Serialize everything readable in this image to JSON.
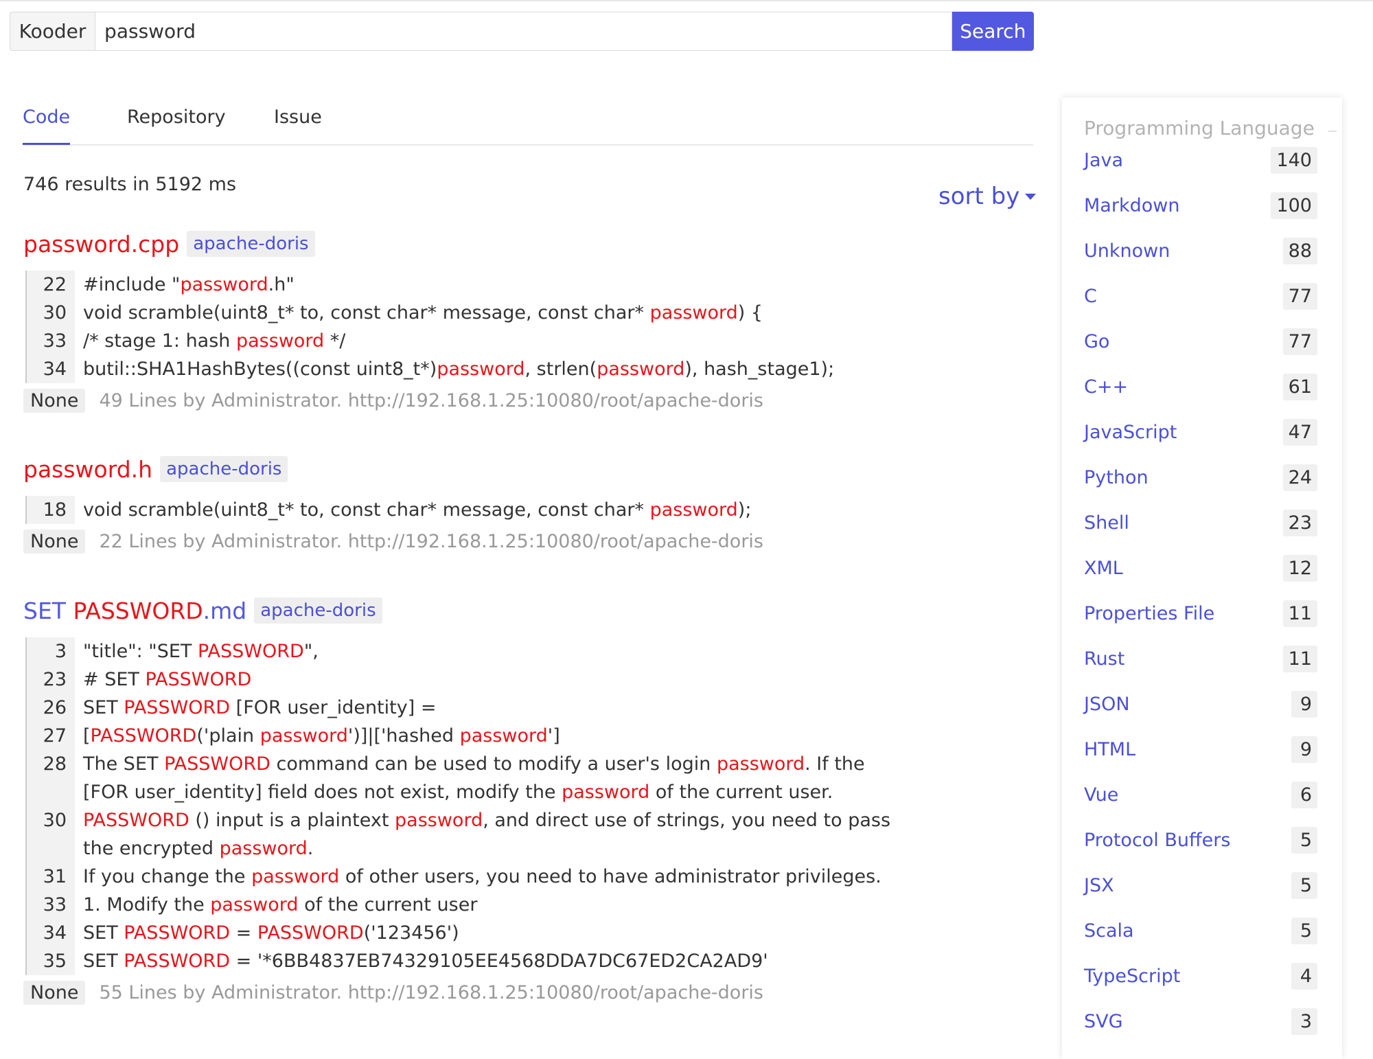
{
  "search": {
    "brand": "Kooder",
    "query": "password",
    "button": "Search"
  },
  "tabs": [
    {
      "label": "Code",
      "active": true
    },
    {
      "label": "Repository",
      "active": false
    },
    {
      "label": "Issue",
      "active": false
    }
  ],
  "summary": "746 results in 5192 ms",
  "sort_label": "sort by",
  "results": [
    {
      "title": [
        {
          "text": "password",
          "hl": true
        },
        {
          "text": ".cpp",
          "hl": true
        }
      ],
      "repo": "apache-doris",
      "lines": [
        {
          "n": "22",
          "parts": [
            {
              "t": "#include \""
            },
            {
              "t": "password",
              "hl": true
            },
            {
              "t": ".h\""
            }
          ]
        },
        {
          "n": "30",
          "parts": [
            {
              "t": "void scramble(uint8_t* to, const char* message, const char* "
            },
            {
              "t": "password",
              "hl": true
            },
            {
              "t": ") {"
            }
          ]
        },
        {
          "n": "33",
          "parts": [
            {
              "t": "/* stage 1: hash "
            },
            {
              "t": "password",
              "hl": true
            },
            {
              "t": " */"
            }
          ]
        },
        {
          "n": "34",
          "parts": [
            {
              "t": "butil::SHA1HashBytes((const uint8_t*)"
            },
            {
              "t": "password",
              "hl": true
            },
            {
              "t": ", strlen("
            },
            {
              "t": "password",
              "hl": true
            },
            {
              "t": "), hash_stage1);"
            }
          ]
        }
      ],
      "tag": "None",
      "meta": "49 Lines by Administrator. http://192.168.1.25:10080/root/apache-doris"
    },
    {
      "title": [
        {
          "text": "password",
          "hl": true
        },
        {
          "text": ".h",
          "hl": true
        }
      ],
      "repo": "apache-doris",
      "lines": [
        {
          "n": "18",
          "parts": [
            {
              "t": "void scramble(uint8_t* to, const char* message, const char* "
            },
            {
              "t": "password",
              "hl": true
            },
            {
              "t": ");"
            }
          ]
        }
      ],
      "tag": "None",
      "meta": "22 Lines by Administrator. http://192.168.1.25:10080/root/apache-doris"
    },
    {
      "title": [
        {
          "text": "SET ",
          "hl": false
        },
        {
          "text": "PASSWORD",
          "hl": true
        },
        {
          "text": ".md",
          "hl": false
        }
      ],
      "repo": "apache-doris",
      "lines": [
        {
          "n": "3",
          "parts": [
            {
              "t": "\"title\": \"SET "
            },
            {
              "t": "PASSWORD",
              "hl": true
            },
            {
              "t": "\","
            }
          ]
        },
        {
          "n": "23",
          "parts": [
            {
              "t": "# SET "
            },
            {
              "t": "PASSWORD",
              "hl": true
            }
          ]
        },
        {
          "n": "26",
          "parts": [
            {
              "t": "SET "
            },
            {
              "t": "PASSWORD",
              "hl": true
            },
            {
              "t": " [FOR user_identity] ="
            }
          ]
        },
        {
          "n": "27",
          "parts": [
            {
              "t": "["
            },
            {
              "t": "PASSWORD",
              "hl": true
            },
            {
              "t": "('plain "
            },
            {
              "t": "password",
              "hl": true
            },
            {
              "t": "')]|['hashed "
            },
            {
              "t": "password",
              "hl": true
            },
            {
              "t": "']"
            }
          ]
        },
        {
          "n": "28",
          "parts": [
            {
              "t": "The SET "
            },
            {
              "t": "PASSWORD",
              "hl": true
            },
            {
              "t": " command can be used to modify a user's login "
            },
            {
              "t": "password",
              "hl": true
            },
            {
              "t": ". If the [FOR user_identity] field does not exist, modify the "
            },
            {
              "t": "password",
              "hl": true
            },
            {
              "t": " of the current user."
            }
          ]
        },
        {
          "n": "30",
          "parts": [
            {
              "t": "PASSWORD",
              "hl": true
            },
            {
              "t": " () input is a plaintext "
            },
            {
              "t": "password",
              "hl": true
            },
            {
              "t": ", and direct use of strings, you need to pass the encrypted "
            },
            {
              "t": "password",
              "hl": true
            },
            {
              "t": "."
            }
          ]
        },
        {
          "n": "31",
          "parts": [
            {
              "t": "If you change the "
            },
            {
              "t": "password",
              "hl": true
            },
            {
              "t": " of other users, you need to have administrator privileges."
            }
          ]
        },
        {
          "n": "33",
          "parts": [
            {
              "t": "1. Modify the "
            },
            {
              "t": "password",
              "hl": true
            },
            {
              "t": " of the current user"
            }
          ]
        },
        {
          "n": "34",
          "parts": [
            {
              "t": "SET "
            },
            {
              "t": "PASSWORD",
              "hl": true
            },
            {
              "t": " = "
            },
            {
              "t": "PASSWORD",
              "hl": true
            },
            {
              "t": "('123456')"
            }
          ]
        },
        {
          "n": "35",
          "parts": [
            {
              "t": "SET "
            },
            {
              "t": "PASSWORD",
              "hl": true
            },
            {
              "t": " = '*6BB4837EB74329105EE4568DDA7DC67ED2CA2AD9'"
            }
          ]
        }
      ],
      "tag": "None",
      "meta": "55 Lines by Administrator. http://192.168.1.25:10080/root/apache-doris"
    }
  ],
  "sidebar": {
    "header": "Programming Language",
    "languages": [
      {
        "name": "Java",
        "count": "140"
      },
      {
        "name": "Markdown",
        "count": "100"
      },
      {
        "name": "Unknown",
        "count": "88"
      },
      {
        "name": "C",
        "count": "77"
      },
      {
        "name": "Go",
        "count": "77"
      },
      {
        "name": "C++",
        "count": "61"
      },
      {
        "name": "JavaScript",
        "count": "47"
      },
      {
        "name": "Python",
        "count": "24"
      },
      {
        "name": "Shell",
        "count": "23"
      },
      {
        "name": "XML",
        "count": "12"
      },
      {
        "name": "Properties File",
        "count": "11"
      },
      {
        "name": "Rust",
        "count": "11"
      },
      {
        "name": "JSON",
        "count": "9"
      },
      {
        "name": "HTML",
        "count": "9"
      },
      {
        "name": "Vue",
        "count": "6"
      },
      {
        "name": "Protocol Buffers",
        "count": "5"
      },
      {
        "name": "JSX",
        "count": "5"
      },
      {
        "name": "Scala",
        "count": "5"
      },
      {
        "name": "TypeScript",
        "count": "4"
      },
      {
        "name": "SVG",
        "count": "3"
      }
    ]
  },
  "colors": {
    "accent": "#5358e0",
    "highlight": "#e8141a",
    "muted": "#999999"
  }
}
